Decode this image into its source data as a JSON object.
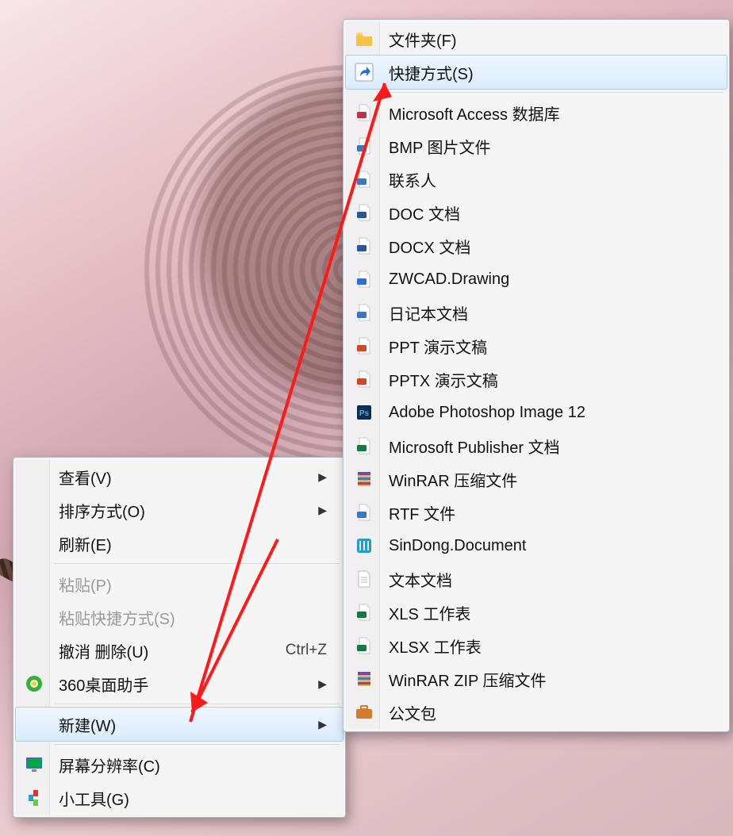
{
  "context_menu": {
    "items": [
      {
        "label": "查看(V)",
        "type": "sub",
        "enabled": true
      },
      {
        "label": "排序方式(O)",
        "type": "sub",
        "enabled": true
      },
      {
        "label": "刷新(E)",
        "type": "item",
        "enabled": true
      },
      {
        "type": "sep"
      },
      {
        "label": "粘贴(P)",
        "type": "item",
        "enabled": false
      },
      {
        "label": "粘贴快捷方式(S)",
        "type": "item",
        "enabled": false
      },
      {
        "label": "撤消 删除(U)",
        "shortcut": "Ctrl+Z",
        "type": "item",
        "enabled": true
      },
      {
        "label": "360桌面助手",
        "type": "sub",
        "enabled": true,
        "icon": "360"
      },
      {
        "type": "sep"
      },
      {
        "label": "新建(W)",
        "type": "sub",
        "enabled": true,
        "highlight": true
      },
      {
        "type": "sep"
      },
      {
        "label": "屏幕分辨率(C)",
        "type": "item",
        "enabled": true,
        "icon": "monitor"
      },
      {
        "label": "小工具(G)",
        "type": "item",
        "enabled": true,
        "icon": "gadget"
      }
    ]
  },
  "new_submenu": {
    "items": [
      {
        "label": "文件夹(F)",
        "icon": "folder"
      },
      {
        "label": "快捷方式(S)",
        "icon": "shortcut",
        "highlight": true
      },
      {
        "type": "sep"
      },
      {
        "label": "Microsoft Access 数据库",
        "icon": "access"
      },
      {
        "label": "BMP 图片文件",
        "icon": "bmp"
      },
      {
        "label": "联系人",
        "icon": "contact"
      },
      {
        "label": "DOC 文档",
        "icon": "doc"
      },
      {
        "label": "DOCX 文档",
        "icon": "docx"
      },
      {
        "label": "ZWCAD.Drawing",
        "icon": "dwg"
      },
      {
        "label": "日记本文档",
        "icon": "journal"
      },
      {
        "label": "PPT 演示文稿",
        "icon": "ppt"
      },
      {
        "label": "PPTX 演示文稿",
        "icon": "pptx"
      },
      {
        "label": "Adobe Photoshop Image 12",
        "icon": "psd"
      },
      {
        "label": "Microsoft Publisher 文档",
        "icon": "pub"
      },
      {
        "label": "WinRAR 压缩文件",
        "icon": "rar"
      },
      {
        "label": "RTF 文件",
        "icon": "rtf"
      },
      {
        "label": "SinDong.Document",
        "icon": "sindong"
      },
      {
        "label": "文本文档",
        "icon": "txt"
      },
      {
        "label": "XLS 工作表",
        "icon": "xls"
      },
      {
        "label": "XLSX 工作表",
        "icon": "xlsx"
      },
      {
        "label": "WinRAR ZIP 压缩文件",
        "icon": "zip"
      },
      {
        "label": "公文包",
        "icon": "briefcase"
      }
    ]
  }
}
